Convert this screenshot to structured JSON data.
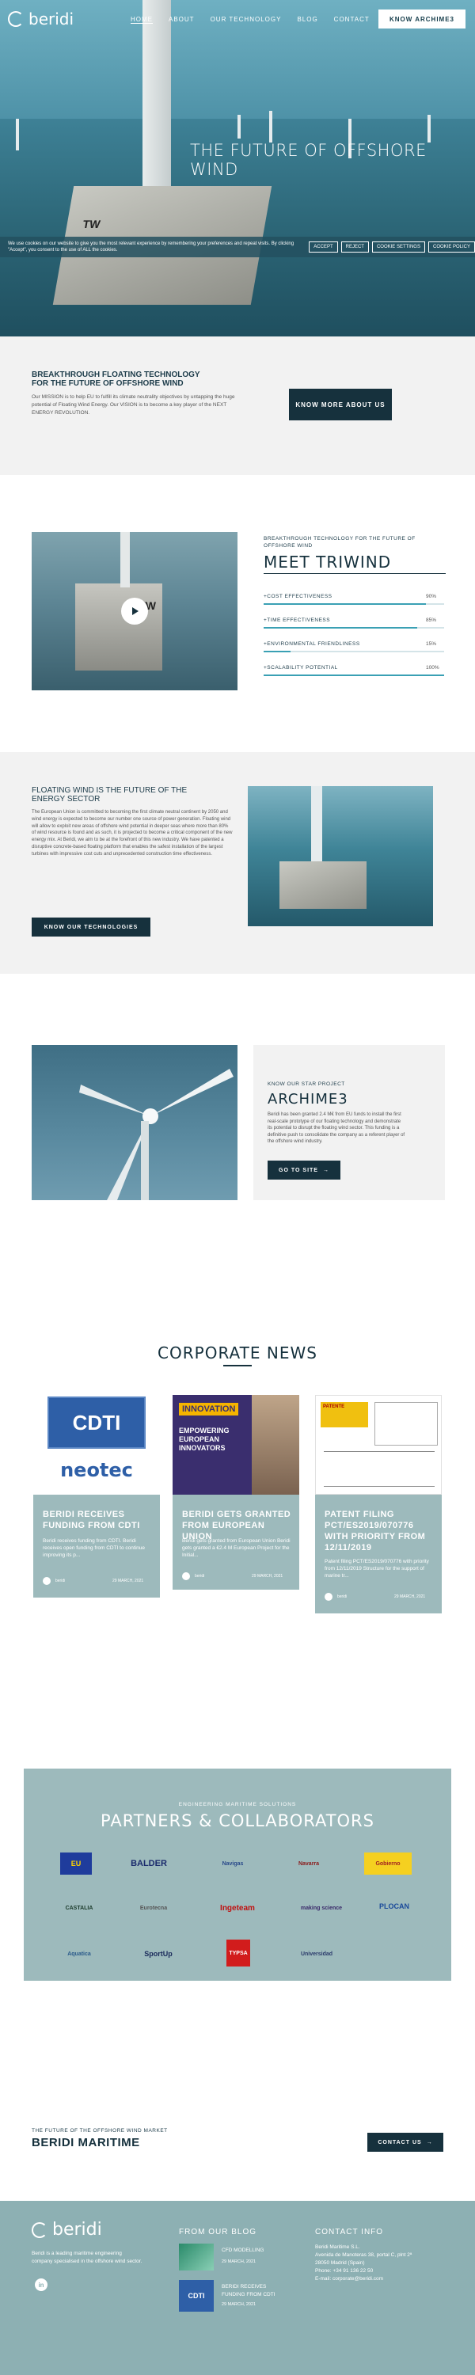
{
  "nav": {
    "logo_text": "beridi",
    "items": [
      "HOME",
      "ABOUT",
      "OUR TECHNOLOGY",
      "BLOG",
      "CONTACT"
    ],
    "cta": "KNOW ARCHIME3"
  },
  "hero": {
    "title": "THE FUTURE OF OFFSHORE WIND",
    "platform_label": "TW"
  },
  "cookie": {
    "text": "We use cookies on our website to give you the most relevant experience by remembering your preferences and repeat visits. By clicking \"Accept\", you consent to the use of ALL the cookies.",
    "buttons": [
      "ACCEPT",
      "REJECT",
      "COOKIE SETTINGS",
      "COOKIE POLICY"
    ]
  },
  "mission": {
    "heading_line1": "BREAKTHROUGH FLOATING TECHNOLOGY",
    "heading_line2": "FOR THE FUTURE OF OFFSHORE WIND",
    "text": "Our MISSION is to help EU to fulfill its climate neutrality objectives by untapping the huge potential of Floating Wind Energy. Our VISION is to become a key player of the NEXT ENERGY REVOLUTION.",
    "button": "KNOW MORE ABOUT US"
  },
  "triwind": {
    "kicker": "BREAKTHROUGH TECHNOLOGY FOR THE FUTURE OF OFFSHORE WIND",
    "title": "MEET TRIWIND",
    "video_label": "TW",
    "bars": [
      {
        "label": "+COST EFFECTIVENESS",
        "value": 90,
        "display": "90%"
      },
      {
        "label": "+TIME EFFECTIVENESS",
        "value": 85,
        "display": "85%"
      },
      {
        "label": "+ENVIRONMENTAL FRIENDLINESS",
        "value": 15,
        "display": "15%"
      },
      {
        "label": "+SCALABILITY POTENTIAL",
        "value": 100,
        "display": "100%"
      }
    ]
  },
  "floating": {
    "heading_line1": "FLOATING WIND IS THE FUTURE OF THE",
    "heading_line2": "ENERGY SECTOR",
    "text": "The European Union is committed to becoming the first climate neutral continent by 2050 and wind energy is expected to become our number one source of power generation. Floating wind will allow to exploit new areas of offshore wind potential in deeper seas where more than 80% of wind resource is found and as such, it is projected to become a critical component of the new energy mix. At Beridi, we aim to be at the forefront of this new industry. We have patented a disruptive concrete-based floating platform that enables the safest installation of the largest turbines with impressive cost cuts and unprecedented construction time effectiveness.",
    "button": "KNOW OUR TECHNOLOGIES"
  },
  "archime": {
    "kicker": "KNOW OUR STAR PROJECT",
    "title": "ARCHIME3",
    "text": "Beridi has been granted 2.4 M€ from EU funds to install the first real-scale prototype of our floating technology and demonstrate its potential to disrupt the floating wind sector. This funding is a definitive push to consolidate the company as a referent player of the offshore wind industry.",
    "button": "GO TO SITE"
  },
  "news": {
    "title": "CORPORATE NEWS",
    "cards": [
      {
        "logo": "CDTI",
        "logo2": "neotec",
        "title": "BERIDI RECEIVES FUNDING FROM CDTI",
        "text": "Beridi receives funding from CDTI. Beridi receives open funding from CDTI to continue improving its p...",
        "author": "beridi",
        "date": "29 MARCH, 2021"
      },
      {
        "logo": "INNOVATION",
        "logo2": "EMPOWERING EUROPEAN INNOVATORS",
        "title": "BERIDI GETS GRANTED FROM EUROPEAN UNION",
        "text": "Beridi gets granted from European Union Beridi gets granted a €2.4 M European Project for the Initial...",
        "author": "beridi",
        "date": "29 MARCH, 2021"
      },
      {
        "logo": "PATENTE",
        "logo2": "",
        "title": "PATENT FILING PCT/ES2019/070776 WITH PRIORITY FROM 12/11/2019",
        "text": "Patent filing PCT/ES2019/070776 with priority from 12/11/2019 Structure for the support of marine tr...",
        "author": "beridi",
        "date": "29 MARCH, 2021"
      }
    ]
  },
  "partners": {
    "kicker": "ENGINEERING MARITIME SOLUTIONS",
    "title": "PARTNERS & COLLABORATORS",
    "logos": [
      "EU",
      "BALDER",
      "Navigas",
      "Navarra",
      "Gobierno",
      "CASTALIA",
      "Eurotecna",
      "Ingeteam",
      "making science",
      "PLOCAN",
      "Aquatica",
      "SportUp",
      "TYPSA",
      "Universidad"
    ]
  },
  "maritime": {
    "kicker": "THE FUTURE OF THE OFFSHORE WIND MARKET",
    "title": "BERIDI MARITIME",
    "button": "CONTACT US"
  },
  "footer": {
    "logo_text": "beridi",
    "about": "Beridi is a leading maritime engineering company specialised in the offshore wind sector.",
    "social": "in",
    "blog_title": "FROM OUR BLOG",
    "blog_posts": [
      {
        "title": "CFD MODELLING",
        "date": "29 MARCH, 2021"
      },
      {
        "title": "BERIDI RECEIVES FUNDING FROM CDTI",
        "date": "29 MARCH, 2021"
      }
    ],
    "contact_title": "CONTACT INFO",
    "contact_lines": [
      "Beridi Maritime S.L.",
      "Avenida de Manoteras 38, portal C, plnt 2ª",
      "28050 Madrid (Spain)",
      "Phone: +34 91 136 22 50",
      "E-mail: corporate@beridi.com"
    ]
  },
  "colors": {
    "dark": "#16313d",
    "accent": "#3aa0b4",
    "card": "#9dbabc",
    "footer": "#8db0b3"
  }
}
